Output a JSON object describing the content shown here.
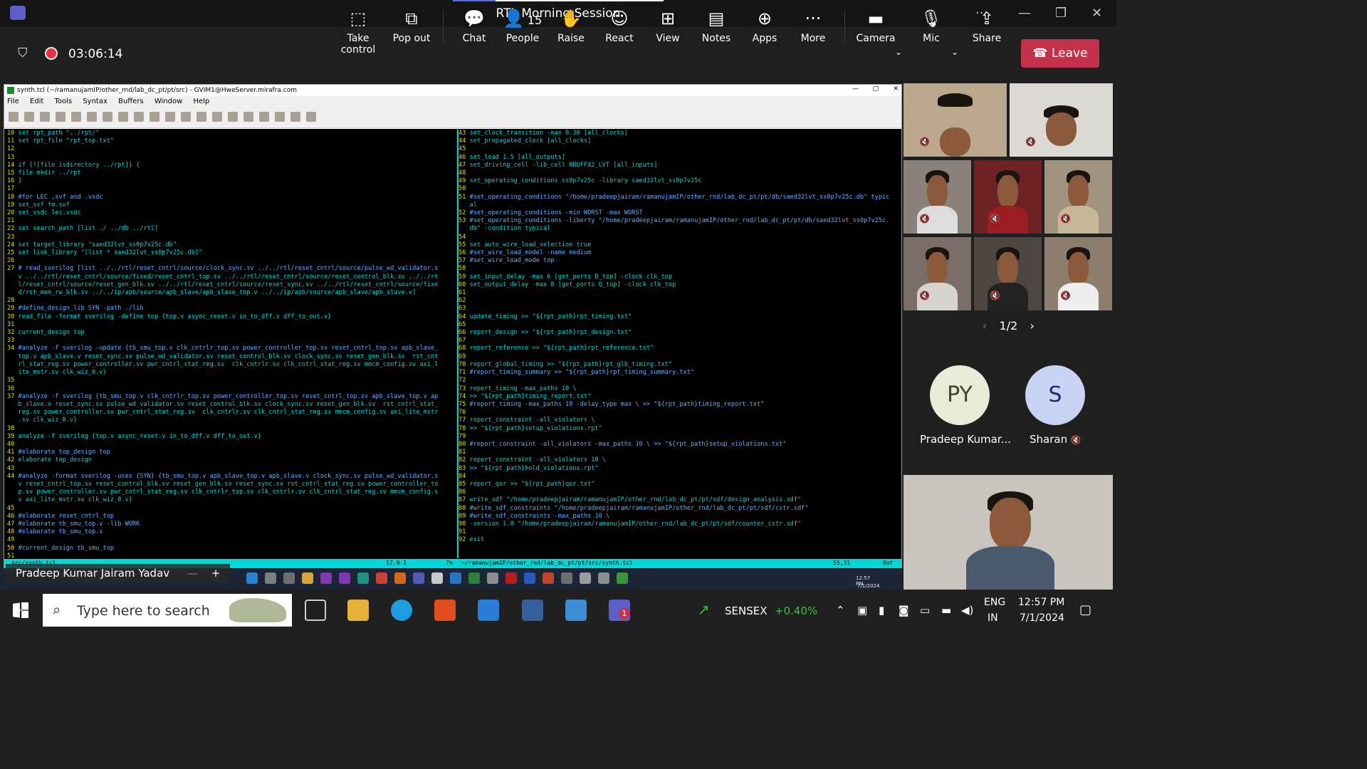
{
  "meeting": {
    "title": "RTL Morning Session",
    "timer": "03:06:14",
    "toolbar": [
      {
        "label": "Take control",
        "icon": "take-control-icon",
        "glyph": "⬚"
      },
      {
        "label": "Pop out",
        "icon": "pop-out-icon",
        "glyph": "⧉"
      },
      {
        "label": "Chat",
        "icon": "chat-icon",
        "glyph": "💬"
      },
      {
        "label": "People",
        "icon": "people-icon",
        "glyph": "👤",
        "count": "15"
      },
      {
        "label": "Raise",
        "icon": "raise-hand-icon",
        "glyph": "✋"
      },
      {
        "label": "React",
        "icon": "react-icon",
        "glyph": "☺"
      },
      {
        "label": "View",
        "icon": "view-icon",
        "glyph": "⊞"
      },
      {
        "label": "Notes",
        "icon": "notes-icon",
        "glyph": "📋"
      },
      {
        "label": "Apps",
        "icon": "apps-icon",
        "glyph": "⊕"
      },
      {
        "label": "More",
        "icon": "more-icon",
        "glyph": "···"
      },
      {
        "label": "Camera",
        "icon": "camera-icon",
        "glyph": "📹"
      },
      {
        "label": "Mic",
        "icon": "mic-off-icon",
        "glyph": "🎙"
      },
      {
        "label": "Share",
        "icon": "share-icon",
        "glyph": "⇪"
      }
    ],
    "leave_label": "Leave",
    "self_name": "Pradeep Kumar Jairam Yadav",
    "pager": "1/2",
    "avatars": [
      {
        "initials": "PY",
        "name": "Pradeep Kumar...",
        "bg": "#e8ebd8",
        "fg": "#3d4a20"
      },
      {
        "initials": "S",
        "name": "Sharan",
        "bg": "#c9d4f5",
        "fg": "#1c2e6e"
      }
    ]
  },
  "gvim": {
    "title": "synth.tcl (~/ramanujamIP/other_rnd/lab_dc_pt/pt/src) - GVIM1@HweServer.mirafra.com",
    "menu": [
      "File",
      "Edit",
      "Tools",
      "Syntax",
      "Buffers",
      "Window",
      "Help"
    ],
    "left_lines": [
      "10 set rpt_path \"../rpt/\"",
      "11 set rpt_file \"rpt_top.txt\"",
      "12",
      "13",
      "14 if {![file isdirectory ../rpt]} {",
      "15 file mkdir ../rpt",
      "16 }",
      "17",
      "18 #for LEC ,svf and .vsdc",
      "19 set_svf fm.svf",
      "20 set_vsdc lec.vsdc",
      "21",
      "22 set search_path [list ./ ../db ../rtl]",
      "23",
      "24 set target_library \"saed32lvt_ss0p7v25c.db\"",
      "25 set link_library \"[list * saed32lvt_ss0p7v25c.db]\"",
      "26",
      "27 # read_sverilog [list ../../rtl/reset_cntrl/source/clock_sync.sv ../../rtl/reset_cntrl/source/pulse_wd_validator.s",
      "   v ../../rtl/reset_cntrl/source/fixed/reset_cntrl_top.sv ../../rtl/reset_cntrl/source/reset_control_blk.sv ../../rt",
      "   l/reset_cntrl/source/reset_gen_blk.sv ../../rtl/reset_cntrl/source/reset_sync.sv ../../rtl/reset_cntrl/source/fixe",
      "   d/rst_mem_rw_blk.sv ../../ip/apb/source/apb_slave/apb_slave_top.v ../../ip/apb/source/apb_slave/apb_slave.v]",
      "28",
      "29 #define_design_lib SYN -path ./lib",
      "30 read_file -format sverilog -define top {top.v async_reset.v in_to_dff.v dff_to_out.v}",
      "31",
      "32 current_design top",
      "33",
      "34 #analyze -f sverilog -update {tb_smu_top.v clk_cntrlr_top.sv power_controller_top.sv reset_cntrl_top.sv apb_slave_",
      "   top.v apb_slave.v reset_sync.sv pulse_wd_validator.sv reset_control_blk.sv clock_sync.sv reset_gen_blk.sv  rst_cnt",
      "   rl_stat_reg.sv power_controller.sv pwr_cntrl_stat_reg.sv  clk_cntrlr.sv clk_cntrl_stat_reg.sv mmcm_config.sv axi_l",
      "   ite_mstr.sv clk_wiz_0.v}",
      "35",
      "36",
      "37 #analyze -f sverilog {tb_smu_top.v clk_cntrlr_top.sv power_controller_top.sv reset_cntrl_top.sv apb_slave_top.v ap",
      "   b_slave.v reset_sync.sv pulse_wd_validator.sv reset_control_blk.sv clock_sync.sv reset_gen_blk.sv  rst_cntrl_stat_",
      "   reg.sv power_controller.sv pwr_cntrl_stat_reg.sv  clk_cntrlr.sv clk_cntrl_stat_reg.sv mmcm_config.sv axi_lite_mstr",
      "   .sv clk_wiz_0.v}",
      "38",
      "39 analyze -f sverilog {top.v async_reset.v in_to_dff.v dff_to_out.v}",
      "40",
      "41 #elaborate top_design top",
      "42 elaborate top_design",
      "43",
      "44 #analyze -format sverilog -uses {SYN} {tb_smu_top.v apb_slave_top.v apb_slave.v clock_sync.sv pulse_wd_validator.s",
      "   v reset_cntrl_top.sv reset_control_blk.sv reset_gen_blk.sv reset_sync.sv rst_cntrl_stat_reg.sv power_controller_to",
      "   p.sv power_controller.sv pwr_cntrl_stat_reg.sv clk_cntrlr_top.sv clk_cntrlr.sv clk_cntrl_stat_reg.sv mmcm_config.s",
      "   v axi_lite_mstr.sv clk_wiz_0.v}",
      "45",
      "46 #elaborate reset_cntrl_top",
      "47 #elaborate tb_smu_top.v -lib WORK",
      "48 #elaborate tb_smu_top.v",
      "49",
      "50 #current_design tb_smu_top",
      "51"
    ],
    "right_lines": [
      "43 set_clock_transition -max 0.30 [all_clocks]",
      "44 set_propagated_clock [all_clocks]",
      "45",
      "46 set_load 1.5 [all_outputs]",
      "47 set_driving_cell -lib_cell NBUFFX2_LVT [all_inputs]",
      "48",
      "49 set_operating_conditions ss0p7v25c -library saed32lvt_ss0p7v25c",
      "50",
      "51 #set_operating_conditions \"/home/pradeepjairam/ramanujamIP/other_rnd/lab_dc_pt/pt/db/saed32lvt_ss0p7v25c.db\" typic",
      "   al",
      "52 #set_operating_conditions -min WORST -max WORST",
      "53 #set_operating_conditions -liberty \"/home/pradeepjairam/ramanujamIP/other_rnd/lab_dc_pt/pt/db/saed32lvt_ss0p7v25c.",
      "   db\" -condition typical",
      "54",
      "55 set auto_wire_load_selection true",
      "56 #set_wire_load_model -name medium",
      "57 #set_wire_load_mode top",
      "58",
      "59 set_input_delay -max 6 [get_ports D_top] -clock clk_top",
      "60 set_output_delay -max 8 [get_ports Q_top] -clock clk_top",
      "61",
      "62",
      "63",
      "64 update_timing >> \"${rpt_path}rpt_timing.txt\"",
      "65",
      "66 report_design >> \"${rpt_path}rpt_design.txt\"",
      "67",
      "68 report_reference >> \"${rpt_path}rpt_reference.txt\"",
      "69",
      "70 report_global_timing >> \"${rpt_path}rpt_glb_timing.txt\"",
      "71 #report_timing_summary >> \"${rpt_path}rpt_timing_summary.txt\"",
      "72",
      "73 report_timing -max_paths 10 \\",
      "74 >> \"${rpt_path}timing_report.txt\"",
      "75 #report_timing -max_paths 10 -delay_type max \\ >> \"${rpt_path}timing_report.txt\"",
      "76",
      "77 report_constraint -all_violators \\",
      "78 >> \"${rpt_path}setup_violations.rpt\"",
      "79",
      "80 #report_constraint -all_violators -max_paths 10 \\ >> \"${rpt_path}setup_violations.txt\"",
      "81",
      "82 report_constraint -all_violators 10 \\",
      "83 >> \"${rpt_path}hold_violations.rpt\"",
      "84",
      "85 report_qor >> \"${rpt_path}qor.txt\"",
      "86",
      "87 write_sdf \"/home/pradeepjairam/ramanujamIP/other_rnd/lab_dc_pt/pt/sdf/design_analysis.sdf\"",
      "88 #write_sdf_constraints \"/home/pradeepjairam/ramanujamIP/other_rnd/lab_dc_pt/pt/sdf/cstr.sdf\"",
      "89 #write_sdf_constraints -max_paths 10 \\",
      "90 -version 1.0 \"/home/pradeepjairam/ramanujamIP/other_rnd/lab_dc_pt/pt/sdf/counter_cstr.sdf\"",
      "91",
      "92 exit"
    ],
    "status_left": "src/synth.tcl",
    "status_left_pos": "17,0-1",
    "status_left_pct": "7%",
    "status_right": "~/ramanujamIP/other_rnd/lab_dc_pt/pt/src/synth.tcl",
    "status_right_pos": "55,31",
    "status_right_pct": "Bot",
    "remote_clock": "12:57 PM",
    "remote_date": "7/1/2024"
  },
  "taskbar": {
    "search_placeholder": "Type here to search",
    "sensex_label": "SENSEX",
    "sensex_change": "+0.40%",
    "lang": "ENG",
    "region": "IN",
    "time": "12:57 PM",
    "date": "7/1/2024",
    "teams_badge": "1"
  }
}
